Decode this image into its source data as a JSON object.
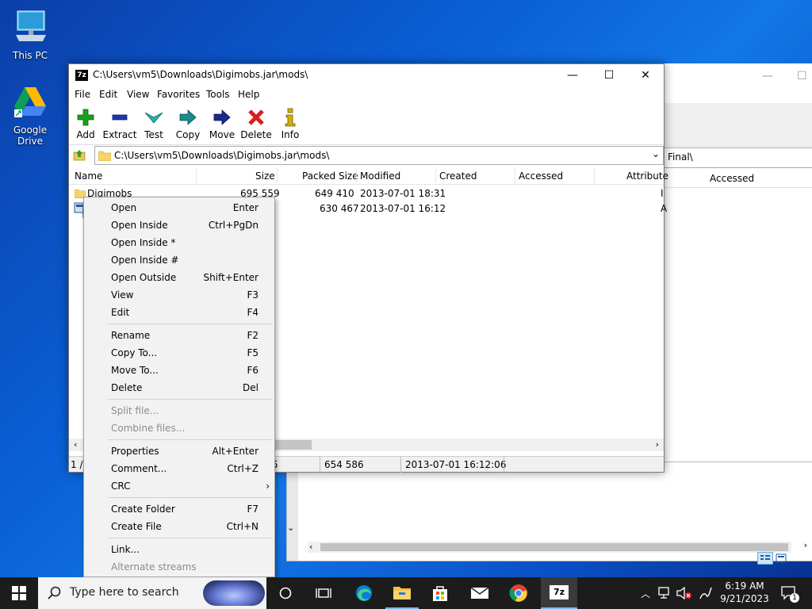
{
  "desktop": {
    "icons": [
      {
        "label": "This PC"
      },
      {
        "label": "Google Drive"
      }
    ]
  },
  "background_window": {
    "address_fragment": "Final\\",
    "column": "Accessed"
  },
  "window": {
    "title": "C:\\Users\\vm5\\Downloads\\Digimobs.jar\\mods\\",
    "app_icon": "7z",
    "controls": {
      "minimize": "—",
      "maximize": "☐",
      "close": "✕"
    },
    "menu": [
      "File",
      "Edit",
      "View",
      "Favorites",
      "Tools",
      "Help"
    ],
    "toolbar": [
      {
        "label": "Add",
        "icon": "add-plus-icon",
        "color": "#1aa01a"
      },
      {
        "label": "Extract",
        "icon": "extract-minus-icon",
        "color": "#1a3aa8"
      },
      {
        "label": "Test",
        "icon": "test-check-icon",
        "color": "#2ab0b0"
      },
      {
        "label": "Copy",
        "icon": "copy-arrow-icon",
        "color": "#1a8a8a"
      },
      {
        "label": "Move",
        "icon": "move-arrow-icon",
        "color": "#1a2a90"
      },
      {
        "label": "Delete",
        "icon": "delete-x-icon",
        "color": "#d81e1e"
      },
      {
        "label": "Info",
        "icon": "info-icon",
        "color": "#d4b000"
      }
    ],
    "address": "C:\\Users\\vm5\\Downloads\\Digimobs.jar\\mods\\",
    "columns": [
      "Name",
      "Size",
      "Packed Size",
      "Modified",
      "Created",
      "Accessed",
      "Attribute"
    ],
    "rows": [
      {
        "name": "Digimobs",
        "size": "695 559",
        "packed": "649 410",
        "modified": "2013-07-01 18:31",
        "attr": "I"
      },
      {
        "name": "",
        "size": "",
        "packed": "630 467",
        "modified": "2013-07-01 16:12",
        "attr": "A"
      }
    ],
    "status": {
      "selection": "1 /",
      "size_frag": "5",
      "packed": "654 586",
      "modified": "2013-07-01 16:12:06"
    }
  },
  "context_menu": {
    "groups": [
      [
        {
          "label": "Open",
          "key": "Enter"
        },
        {
          "label": "Open Inside",
          "key": "Ctrl+PgDn"
        },
        {
          "label": "Open Inside *",
          "key": ""
        },
        {
          "label": "Open Inside #",
          "key": ""
        },
        {
          "label": "Open Outside",
          "key": "Shift+Enter"
        },
        {
          "label": "View",
          "key": "F3"
        },
        {
          "label": "Edit",
          "key": "F4"
        }
      ],
      [
        {
          "label": "Rename",
          "key": "F2"
        },
        {
          "label": "Copy To...",
          "key": "F5"
        },
        {
          "label": "Move To...",
          "key": "F6"
        },
        {
          "label": "Delete",
          "key": "Del"
        }
      ],
      [
        {
          "label": "Split file...",
          "key": "",
          "disabled": true
        },
        {
          "label": "Combine files...",
          "key": "",
          "disabled": true
        }
      ],
      [
        {
          "label": "Properties",
          "key": "Alt+Enter"
        },
        {
          "label": "Comment...",
          "key": "Ctrl+Z"
        },
        {
          "label": "CRC",
          "key": "›"
        }
      ],
      [
        {
          "label": "Create Folder",
          "key": "F7"
        },
        {
          "label": "Create File",
          "key": "Ctrl+N"
        }
      ],
      [
        {
          "label": "Link...",
          "key": ""
        },
        {
          "label": "Alternate streams",
          "key": "",
          "disabled": true
        }
      ]
    ]
  },
  "taskbar": {
    "search_placeholder": "Type here to search",
    "time": "6:19 AM",
    "date": "9/21/2023",
    "notification_count": "1"
  }
}
